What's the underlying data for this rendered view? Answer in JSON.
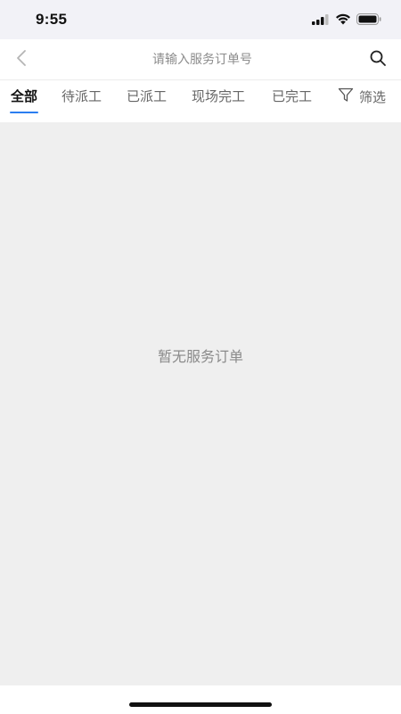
{
  "status_bar": {
    "time": "9:55",
    "icons": [
      "signal-icon",
      "wifi-icon",
      "battery-icon"
    ]
  },
  "header": {
    "back_icon": "chevron-left-icon",
    "search_placeholder": "请输入服务订单号",
    "search_value": "",
    "search_icon": "search-icon"
  },
  "tabs": [
    {
      "label": "全部",
      "active": true
    },
    {
      "label": "待派工",
      "active": false
    },
    {
      "label": "已派工",
      "active": false
    },
    {
      "label": "现场完工",
      "active": false
    },
    {
      "label": "已完工",
      "active": false
    }
  ],
  "filter": {
    "icon": "filter-icon",
    "label": "筛选"
  },
  "empty_state": {
    "message": "暂无服务订单"
  },
  "colors": {
    "accent": "#2b7ef0",
    "content_background": "#efefef",
    "status_bar_background": "#f2f2f7"
  }
}
